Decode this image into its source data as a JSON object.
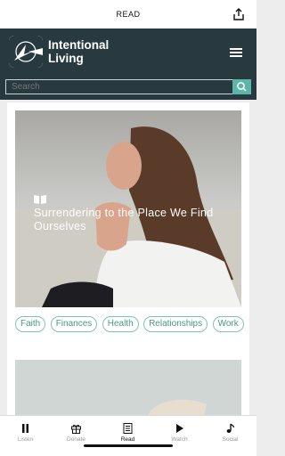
{
  "topbar": {
    "title": "READ"
  },
  "brand": {
    "line1": "Intentional",
    "line2": "Living"
  },
  "search": {
    "placeholder": "Search"
  },
  "article": {
    "title": "Surrendering to the Place We Find Ourselves"
  },
  "tags": [
    "Faith",
    "Finances",
    "Health",
    "Relationships",
    "Work"
  ],
  "tabs": [
    {
      "label": "Listen",
      "icon": "pause-icon",
      "active": false
    },
    {
      "label": "Donate",
      "icon": "gift-icon",
      "active": false
    },
    {
      "label": "Read",
      "icon": "document-icon",
      "active": true
    },
    {
      "label": "Watch",
      "icon": "play-icon",
      "active": false
    },
    {
      "label": "Social",
      "icon": "music-note-icon",
      "active": false
    }
  ],
  "colors": {
    "header": "#283a40",
    "accent": "#5bb5a8",
    "tag_border": "#7cc3b7"
  }
}
